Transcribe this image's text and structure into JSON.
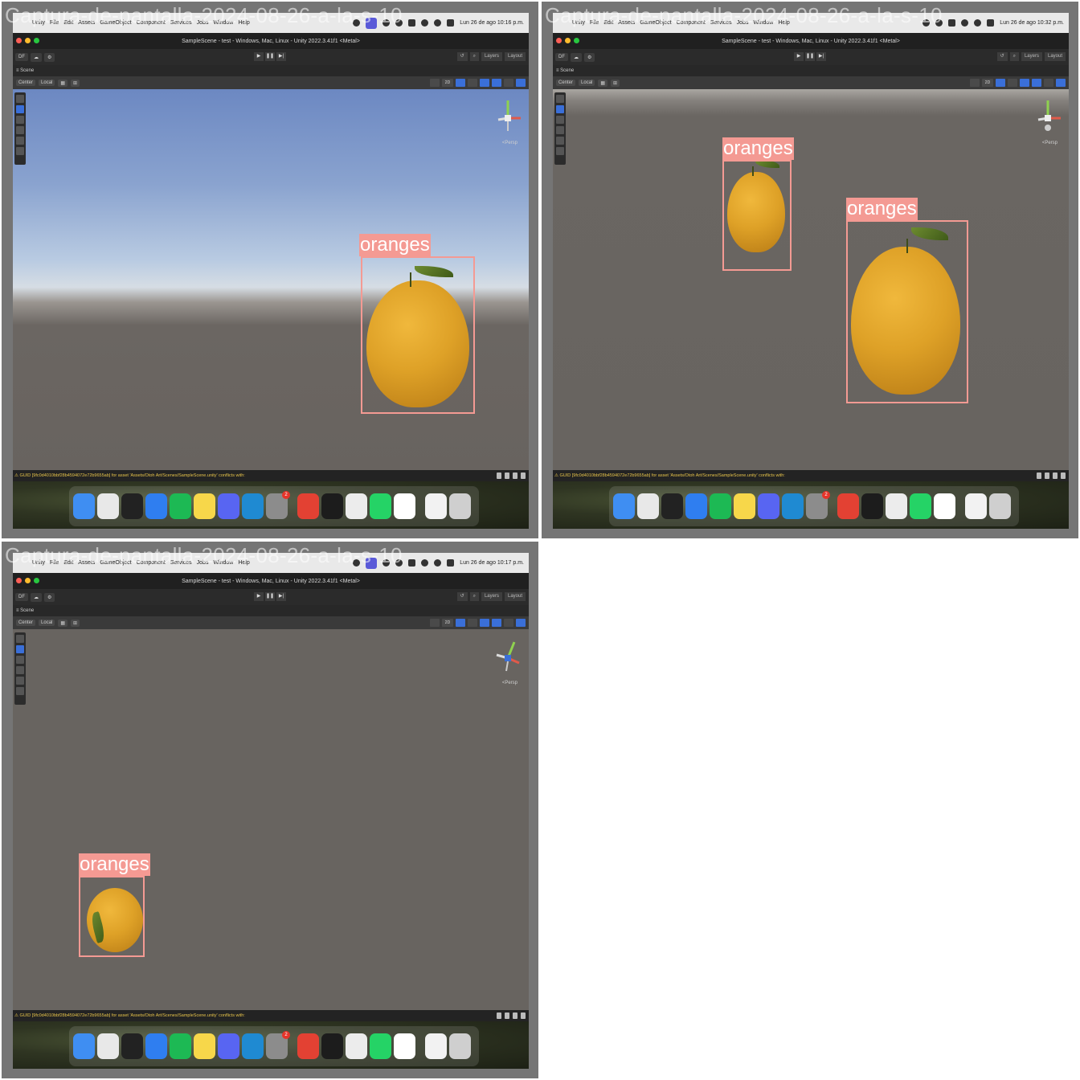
{
  "tiles": [
    {
      "title": "Captura-de-pantalla-2024-08-26-a-la-s-10",
      "clock": "Lun 26 de ago 10:16 p.m.",
      "scene_style": "sky",
      "detections": [
        {
          "label": "oranges"
        }
      ]
    },
    {
      "title": "Captura-de-pantalla-2024-08-26-a-la-s-10",
      "clock": "Lun 26 de ago 10:32 p.m.",
      "scene_style": "ground",
      "detections": [
        {
          "label": "oranges"
        },
        {
          "label": "oranges"
        }
      ]
    },
    {
      "title": "Captura-de-pantalla-2024-08-26-a-la-s-10",
      "clock": "Lun 26 de ago 10:17 p.m.",
      "scene_style": "flat",
      "detections": [
        {
          "label": "oranges"
        }
      ]
    }
  ],
  "menubar": {
    "items": [
      "Unity",
      "File",
      "Edit",
      "Assets",
      "GameObject",
      "Component",
      "Services",
      "Jobs",
      "Window",
      "Help"
    ]
  },
  "window": {
    "title": "SampleScene - test - Windows, Mac, Linux - Unity 2022.3.41f1 <Metal>"
  },
  "toolbar": {
    "account": "DF",
    "layers_label": "Layers",
    "layout_label": "Layout"
  },
  "scene": {
    "tab_label": "Scene",
    "pivot_label": "Center",
    "space_label": "Local",
    "mode_2d": "2D",
    "persp_label": "<Persp"
  },
  "console": {
    "message": "GUID [9fc0d4010bbf28b4594072e72b9655ab] for asset 'Assets/Otoh Art/Scenes/SampleScene.unity' conflicts with:"
  },
  "dock": {
    "apps": [
      "finder-icon",
      "launchpad-icon",
      "terminal-icon",
      "safari-icon",
      "spotify-icon",
      "notes-icon",
      "discord-icon",
      "vscode-icon",
      "settings-icon",
      "chrome-icon",
      "terminal2-icon",
      "unity-icon",
      "whatsapp-icon",
      "unity-hub-icon",
      "document-icon",
      "trash-icon"
    ],
    "colors": [
      "#3f8ef2",
      "#e8e8e8",
      "#222222",
      "#2f7ef0",
      "#1db954",
      "#f7d74a",
      "#5865f2",
      "#1f8ad2",
      "#8c8c8c",
      "#e34133",
      "#1c1c1c",
      "#ececec",
      "#25d366",
      "#ffffff",
      "#f2f2f2",
      "#cfcfcf"
    ],
    "settings_badge": "2"
  }
}
